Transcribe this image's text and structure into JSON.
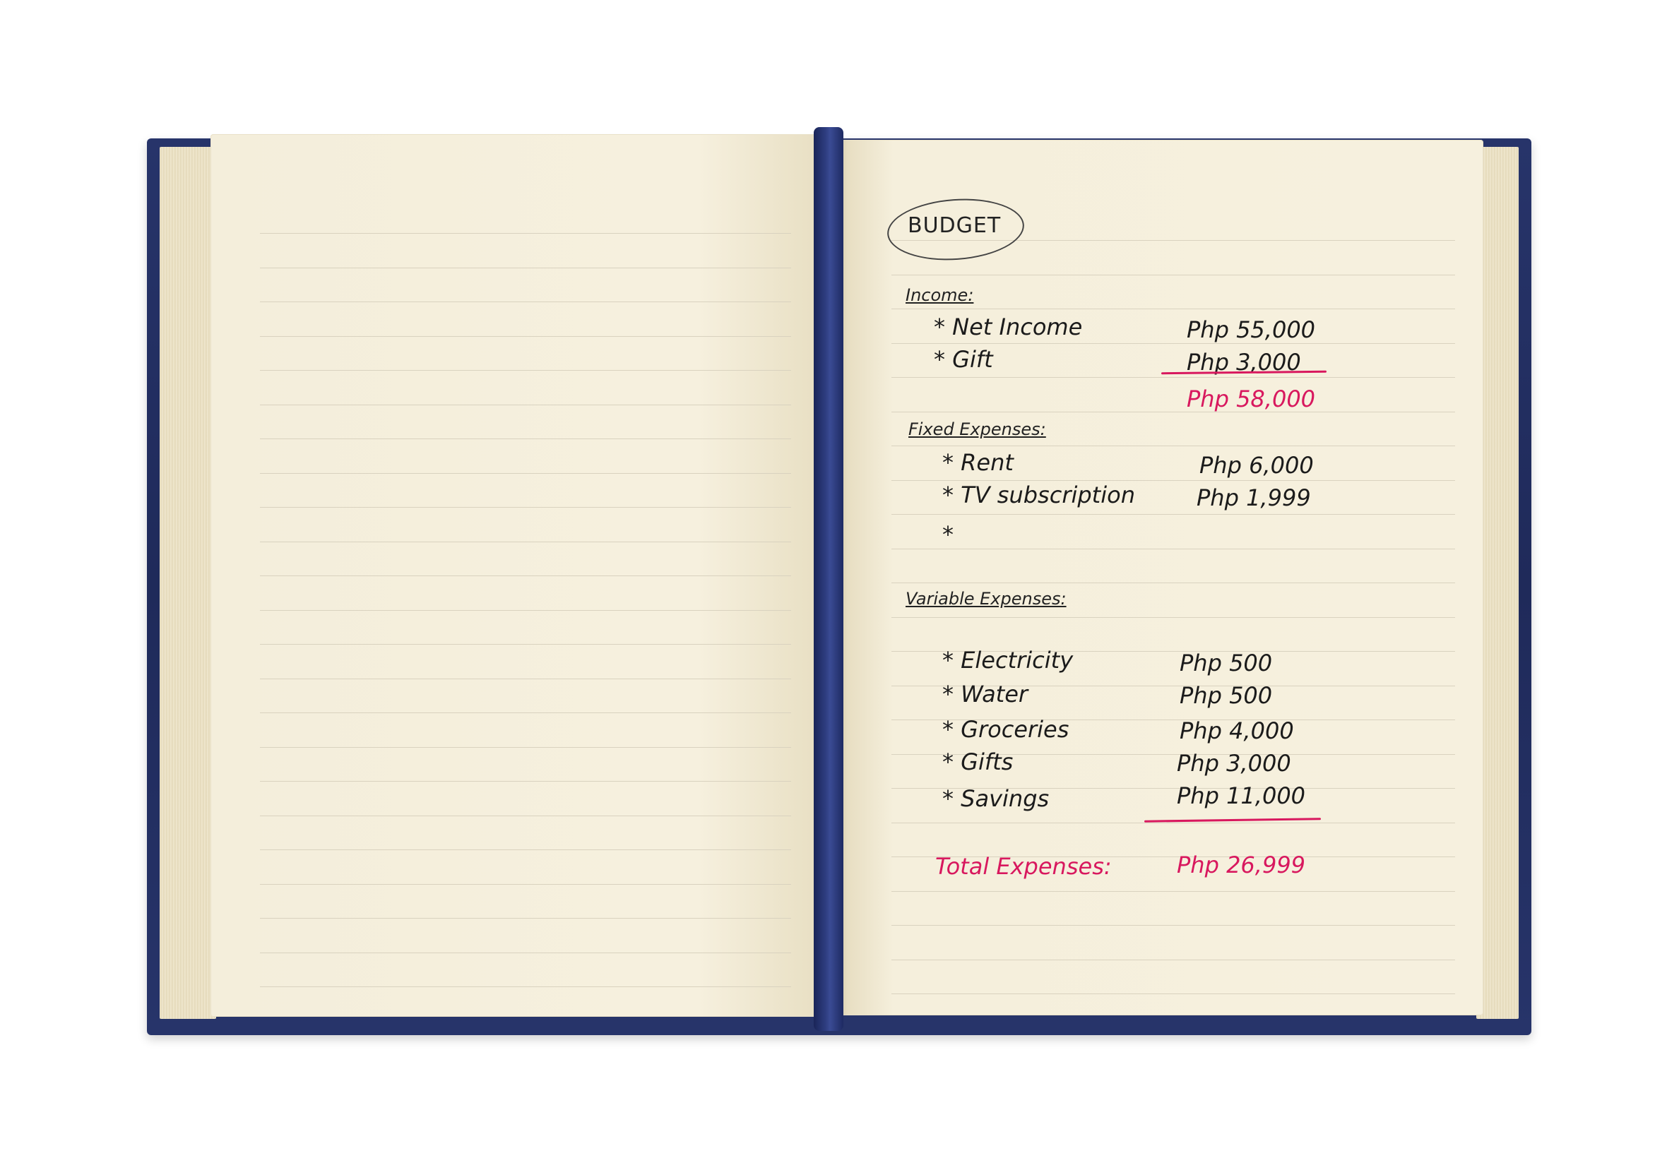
{
  "notebook": {
    "title": "BUDGET",
    "income": {
      "heading": "Income:",
      "items": [
        {
          "label": "Net Income",
          "amount": "Php 55,000"
        },
        {
          "label": "Gift",
          "amount": "Php 3,000"
        }
      ],
      "total": "Php 58,000"
    },
    "fixed_expenses": {
      "heading": "Fixed Expenses:",
      "items": [
        {
          "label": "Rent",
          "amount": "Php 6,000"
        },
        {
          "label": "TV subscription",
          "amount": "Php 1,999"
        }
      ],
      "empty_bullet": "*"
    },
    "variable_expenses": {
      "heading": "Variable Expenses:",
      "items": [
        {
          "label": "Electricity",
          "amount": "Php 500"
        },
        {
          "label": "Water",
          "amount": "Php 500"
        },
        {
          "label": "Groceries",
          "amount": "Php 4,000"
        },
        {
          "label": "Gifts",
          "amount": "Php 3,000"
        },
        {
          "label": "Savings",
          "amount": "Php 11,000"
        }
      ]
    },
    "total_expenses": {
      "label": "Total Expenses:",
      "amount": "Php 26,999"
    },
    "bullet": "*",
    "colors": {
      "cover": "#27346a",
      "paper": "#f6f0de",
      "ink": "#1b1b1b",
      "red_ink": "#d8185e"
    }
  }
}
